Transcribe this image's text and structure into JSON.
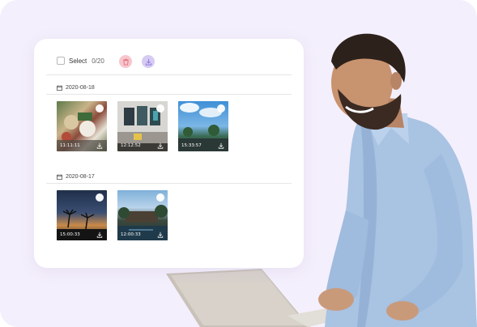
{
  "toolbar": {
    "select_label": "Select",
    "count": "0/20",
    "delete_icon": "trash-icon",
    "download_icon": "download-icon"
  },
  "groups": [
    {
      "date": "2020-08-18",
      "photos": [
        {
          "time": "11:11:11",
          "scene": "food"
        },
        {
          "time": "12:12:52",
          "scene": "interior"
        },
        {
          "time": "15:33:57",
          "scene": "sky"
        }
      ]
    },
    {
      "date": "2020-08-17",
      "photos": [
        {
          "time": "15:00:33",
          "scene": "sunset"
        },
        {
          "time": "12:00:33",
          "scene": "resort"
        }
      ]
    }
  ],
  "colors": {
    "background": "#f4effc",
    "delete_button": "#f7c6cd",
    "download_button": "#d6cbf2",
    "shirt": "#a9c3e3"
  }
}
